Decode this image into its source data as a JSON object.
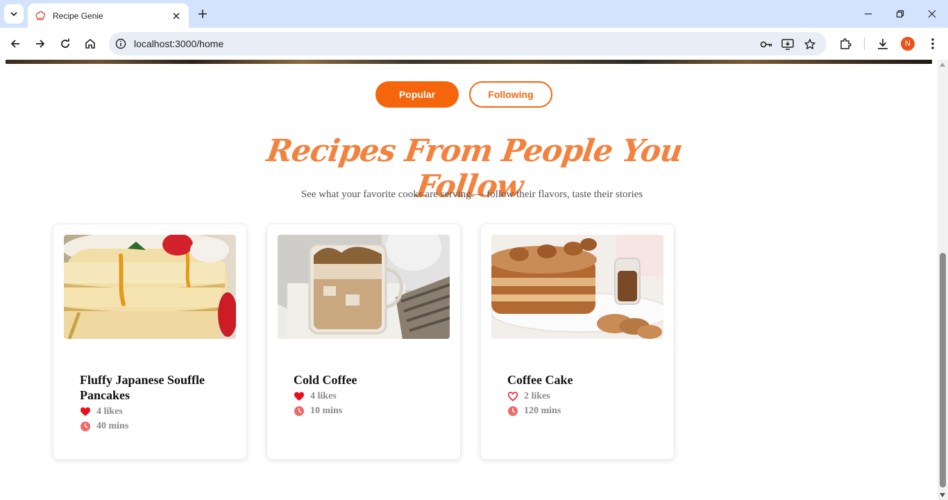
{
  "browser": {
    "tab_title": "Recipe Genie",
    "url": "localhost:3000/home",
    "profile_initial": "N"
  },
  "toggles": {
    "popular_label": "Popular",
    "following_label": "Following"
  },
  "section": {
    "heading": "Recipes From People You Follow",
    "subheading": "See what your favorite cooks are serving — follow their flavors, taste their stories"
  },
  "recipes": [
    {
      "title": "Fluffy Japanese Souffle Pancakes",
      "likes": "4 likes",
      "time": "40 mins",
      "liked": true
    },
    {
      "title": "Cold Coffee",
      "likes": "4 likes",
      "time": "10 mins",
      "liked": true
    },
    {
      "title": "Coffee Cake",
      "likes": "2 likes",
      "time": "120 mins",
      "liked": false
    }
  ],
  "colors": {
    "accent": "#f5650c",
    "heading": "#f4823f",
    "heart": "#e8101e",
    "clock": "#ee6a6a"
  }
}
